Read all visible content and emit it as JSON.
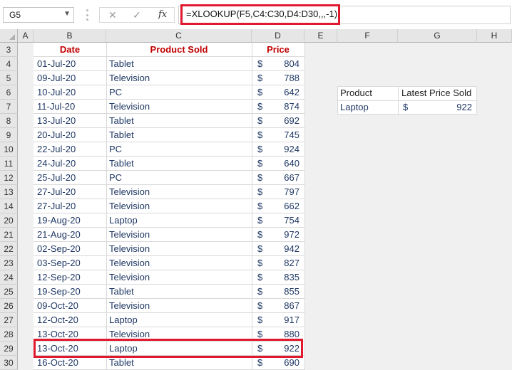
{
  "formula_bar": {
    "name_box": "G5",
    "cancel_icon": "✕",
    "enter_icon": "✓",
    "fx_label": "fx",
    "formula": "=XLOOKUP(F5,C4:C30,D4:D30,,,-1)"
  },
  "columns": [
    "A",
    "B",
    "C",
    "D",
    "E",
    "F",
    "G",
    "H"
  ],
  "rows": [
    "3",
    "4",
    "5",
    "6",
    "7",
    "8",
    "9",
    "10",
    "11",
    "12",
    "13",
    "14",
    "20",
    "21",
    "22",
    "23",
    "24",
    "25",
    "26",
    "27",
    "28",
    "29",
    "30"
  ],
  "table": {
    "headers": {
      "date": "Date",
      "product": "Product Sold",
      "price": "Price"
    },
    "currency": "$",
    "records": [
      {
        "date": "01-Jul-20",
        "product": "Tablet",
        "price": "804"
      },
      {
        "date": "09-Jul-20",
        "product": "Television",
        "price": "788"
      },
      {
        "date": "10-Jul-20",
        "product": "PC",
        "price": "642"
      },
      {
        "date": "11-Jul-20",
        "product": "Television",
        "price": "874"
      },
      {
        "date": "13-Jul-20",
        "product": "Tablet",
        "price": "692"
      },
      {
        "date": "20-Jul-20",
        "product": "Tablet",
        "price": "745"
      },
      {
        "date": "22-Jul-20",
        "product": "PC",
        "price": "924"
      },
      {
        "date": "24-Jul-20",
        "product": "Tablet",
        "price": "640"
      },
      {
        "date": "25-Jul-20",
        "product": "PC",
        "price": "667"
      },
      {
        "date": "27-Jul-20",
        "product": "Television",
        "price": "797"
      },
      {
        "date": "27-Jul-20",
        "product": "Television",
        "price": "662"
      },
      {
        "date": "19-Aug-20",
        "product": "Laptop",
        "price": "754"
      },
      {
        "date": "21-Aug-20",
        "product": "Television",
        "price": "972"
      },
      {
        "date": "02-Sep-20",
        "product": "Television",
        "price": "942"
      },
      {
        "date": "03-Sep-20",
        "product": "Television",
        "price": "827"
      },
      {
        "date": "12-Sep-20",
        "product": "Television",
        "price": "835"
      },
      {
        "date": "19-Sep-20",
        "product": "Tablet",
        "price": "855"
      },
      {
        "date": "09-Oct-20",
        "product": "Television",
        "price": "867"
      },
      {
        "date": "12-Oct-20",
        "product": "Laptop",
        "price": "917"
      },
      {
        "date": "13-Oct-20",
        "product": "Television",
        "price": "880"
      },
      {
        "date": "13-Oct-20",
        "product": "Laptop",
        "price": "922"
      },
      {
        "date": "16-Oct-20",
        "product": "Tablet",
        "price": "690"
      }
    ]
  },
  "lookup": {
    "product_header": "Product",
    "price_header": "Latest Price Sold",
    "product_value": "Laptop",
    "currency": "$",
    "price_value": "922"
  },
  "colors": {
    "header_text": "#c00000",
    "body_text": "#1f3864",
    "highlight": "#e0192f"
  }
}
